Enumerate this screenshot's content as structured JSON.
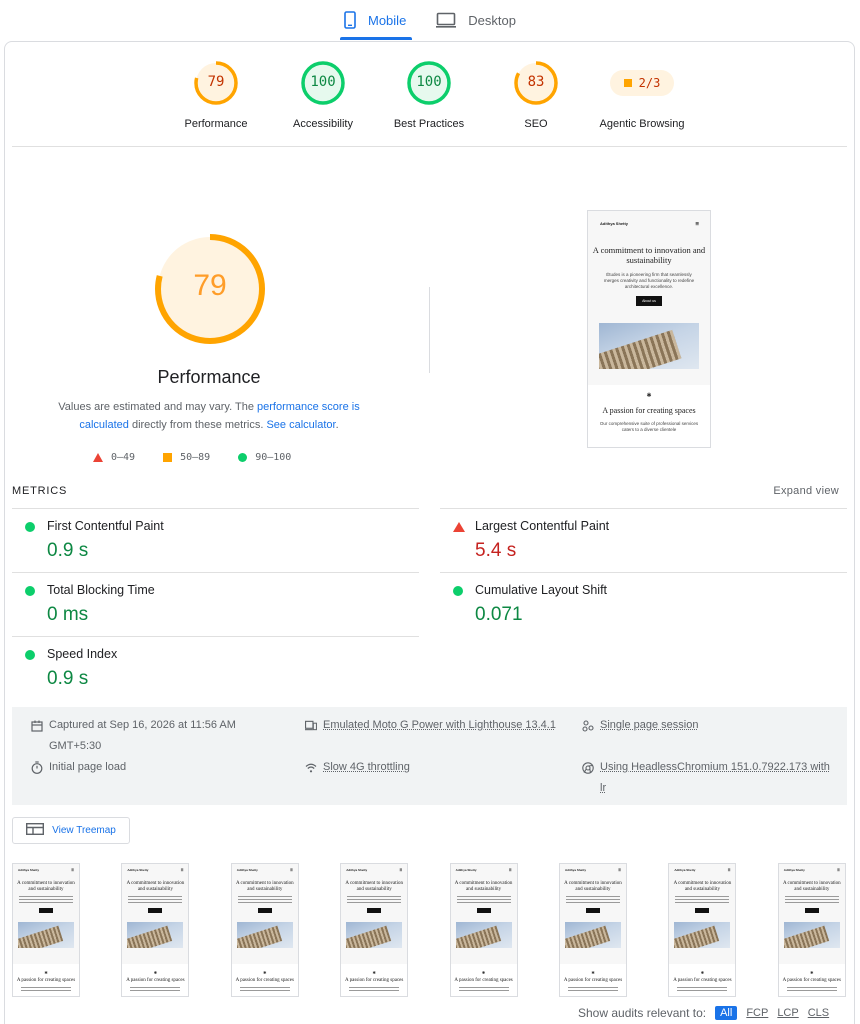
{
  "tabs": {
    "mobile": "Mobile",
    "desktop": "Desktop"
  },
  "scores": {
    "performance": {
      "score": "79",
      "label": "Performance",
      "fraction": 0.79
    },
    "accessibility": {
      "score": "100",
      "label": "Accessibility",
      "fraction": 1.0
    },
    "best_practices": {
      "score": "100",
      "label": "Best Practices",
      "fraction": 1.0
    },
    "seo": {
      "score": "83",
      "label": "SEO",
      "fraction": 0.83
    },
    "agentic": {
      "value": "2/3",
      "label": "Agentic Browsing"
    }
  },
  "colors": {
    "pass": "#0cce6b",
    "average": "#ffa400",
    "fail": "#eb4335",
    "accent": "#1a73e8"
  },
  "detail": {
    "score": "79",
    "title": "Performance",
    "desc_pre": "Values are estimated and may vary. The ",
    "desc_link1": "performance score is calculated",
    "desc_mid": " directly from these metrics. ",
    "desc_link2": "See calculator",
    "desc_post": ".",
    "legend": {
      "fail": "0–49",
      "average": "50–89",
      "pass": "90–100"
    }
  },
  "screenshot": {
    "site_name": "Adithya Shetty",
    "heading": "A commitment to innovation and sustainability",
    "body": "Études is a pioneering firm that seamlessly merges creativity and functionality to redefine architectural excellence.",
    "button": "About us",
    "heading2": "A passion for creating spaces",
    "body2": "Our comprehensive suite of professional services caters to a diverse clientele"
  },
  "metrics": {
    "title": "METRICS",
    "expand": "Expand view",
    "fcp": {
      "name": "First Contentful Paint",
      "value": "0.9 s"
    },
    "lcp": {
      "name": "Largest Contentful Paint",
      "value": "5.4 s"
    },
    "tbt": {
      "name": "Total Blocking Time",
      "value": "0 ms"
    },
    "cls": {
      "name": "Cumulative Layout Shift",
      "value": "0.071"
    },
    "si": {
      "name": "Speed Index",
      "value": "0.9 s"
    }
  },
  "env": {
    "captured": "Captured at Sep 16, 2026 at 11:56 AM GMT+5:30",
    "initial_load": "Initial page load",
    "device": "Emulated Moto G Power with Lighthouse 13.4.1",
    "throttling": "Slow 4G throttling",
    "session": "Single page session",
    "browser": "Using HeadlessChromium 151.0.7922.173 with lr"
  },
  "treemap_label": "View Treemap",
  "filter": {
    "label": "Show audits relevant to:",
    "chips": [
      "All",
      "FCP",
      "LCP",
      "CLS"
    ]
  }
}
